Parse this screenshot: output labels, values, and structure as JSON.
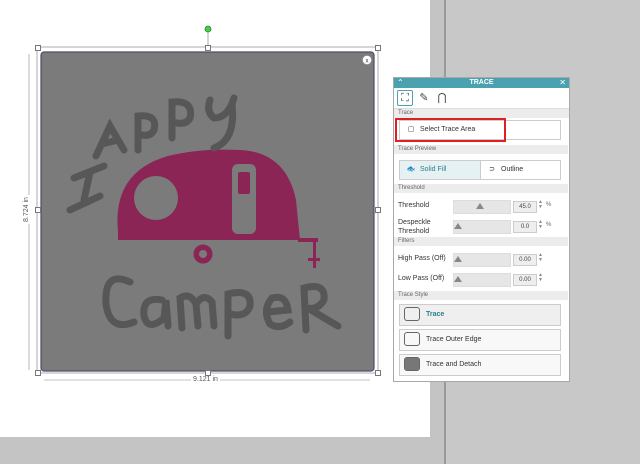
{
  "canvas": {
    "artwork_text_top": "HAPPY",
    "artwork_text_bottom": "CAMPER",
    "width_label": "9.121 in",
    "height_label": "8.724 in",
    "colors": {
      "background": "#7b7b7b",
      "camper": "#8a2556",
      "text": "#575757"
    }
  },
  "trace_panel": {
    "title": "TRACE",
    "section_trace": "Trace",
    "select_trace_area": "Select Trace Area",
    "section_preview": "Trace Preview",
    "solid_fill": "Solid Fill",
    "outline": "Outline",
    "section_threshold": "Threshold",
    "threshold_label": "Threshold",
    "threshold_value": "45.0",
    "despeckle_label_1": "Despeckle",
    "despeckle_label_2": "Threshold",
    "despeckle_value": "0.0",
    "percent": "%",
    "section_filters": "Filters",
    "high_pass_label": "High Pass (Off)",
    "high_pass_value": "0.00",
    "low_pass_label": "Low Pass (Off)",
    "low_pass_value": "0.00",
    "section_style": "Trace Style",
    "trace_btn": "Trace",
    "trace_outer_edge_btn": "Trace Outer Edge",
    "trace_detach_btn": "Trace and Detach",
    "accent_color": "#4aa1b0",
    "highlight_color": "#e02020"
  }
}
